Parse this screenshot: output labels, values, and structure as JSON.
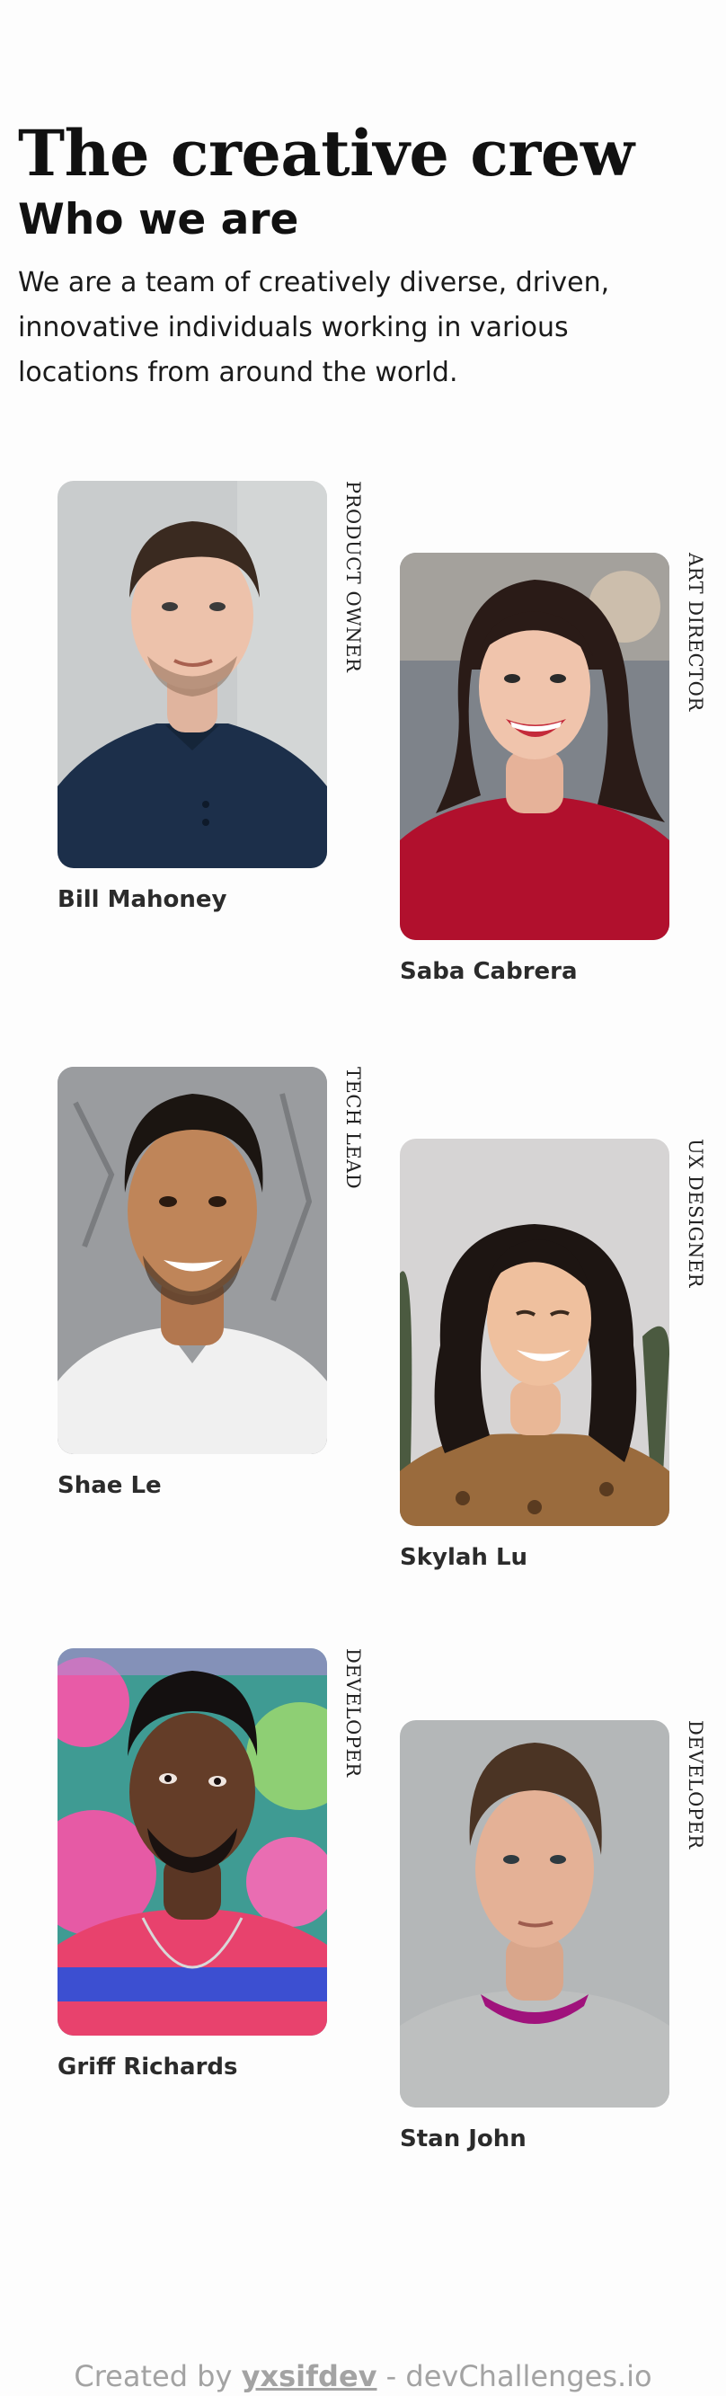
{
  "header": {
    "title": "The creative crew",
    "subtitle": "Who we are",
    "intro": "We are a team of creatively diverse, driven, innovative individuals working in various locations from around the world."
  },
  "members": [
    {
      "name": "Bill Mahoney",
      "role": "PRODUCT OWNER"
    },
    {
      "name": "Saba Cabrera",
      "role": "ART DIRECTOR"
    },
    {
      "name": "Shae Le",
      "role": "TECH LEAD"
    },
    {
      "name": "Skylah Lu",
      "role": "UX DESIGNER"
    },
    {
      "name": "Griff Richards",
      "role": "DEVELOPER"
    },
    {
      "name": "Stan John",
      "role": "DEVELOPER"
    }
  ],
  "footer": {
    "prefix": "Created by",
    "author": "yxsifdev",
    "separator": "-",
    "site": "devChallenges.io"
  },
  "colors": {
    "text": "#0b0b0b",
    "name": "#2b2b2b",
    "footer": "#a3a3a3",
    "background": "#fdfdfd"
  }
}
